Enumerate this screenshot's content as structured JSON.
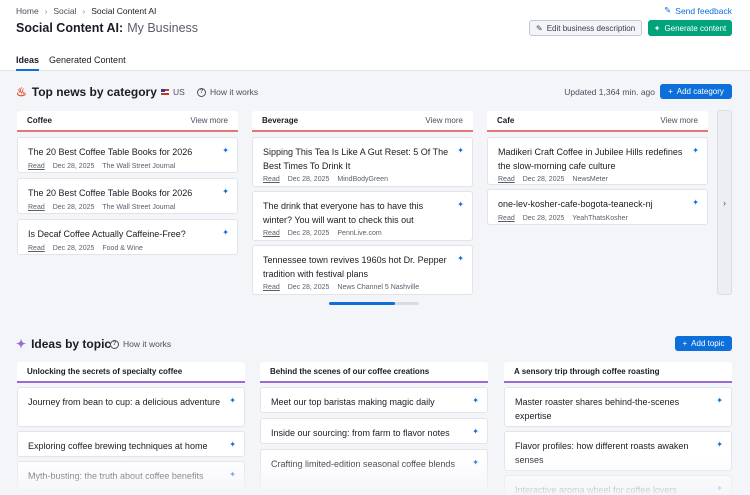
{
  "breadcrumb": [
    "Home",
    "Social",
    "Social Content AI"
  ],
  "send_feedback": "Send feedback",
  "title": {
    "app": "Social Content AI:",
    "business": "My Business"
  },
  "buttons": {
    "edit": "Edit business description",
    "generate": "Generate content",
    "add_category": "Add category",
    "add_topic": "Add topic"
  },
  "tabs": [
    {
      "label": "Ideas",
      "active": true
    },
    {
      "label": "Generated Content",
      "active": false
    }
  ],
  "top_news": {
    "title": "Top news by category",
    "region": "US",
    "how": "How it works",
    "updated": "Updated 1,364 min. ago",
    "view_more": "View more",
    "columns": [
      {
        "name": "Coffee",
        "items": [
          {
            "title": "The 20 Best Coffee Table Books for 2026",
            "read": "Read",
            "date": "Dec 28, 2025",
            "source": "The Wall Street Journal"
          },
          {
            "title": "The 20 Best Coffee Table Books for 2026",
            "read": "Read",
            "date": "Dec 28, 2025",
            "source": "The Wall Street Journal"
          },
          {
            "title": "Is Decaf Coffee Actually Caffeine-Free?",
            "read": "Read",
            "date": "Dec 28, 2025",
            "source": "Food & Wine"
          }
        ]
      },
      {
        "name": "Beverage",
        "items": [
          {
            "title": "Sipping This Tea Is Like A Gut Reset: 5 Of The Best Times To Drink It",
            "read": "Read",
            "date": "Dec 28, 2025",
            "source": "MindBodyGreen"
          },
          {
            "title": "The drink that everyone has to have this winter? You will want to check this out",
            "read": "Read",
            "date": "Dec 28, 2025",
            "source": "PennLive.com"
          },
          {
            "title": "Tennessee town revives 1960s hot Dr. Pepper tradition with festival plans",
            "read": "Read",
            "date": "Dec 28, 2025",
            "source": "News Channel 5 Nashville"
          }
        ]
      },
      {
        "name": "Cafe",
        "items": [
          {
            "title": "Madikeri Craft Coffee in Jubilee Hills redefines the slow-morning cafe culture",
            "read": "Read",
            "date": "Dec 28, 2025",
            "source": "NewsMeter"
          },
          {
            "title": "one-lev-kosher-cafe-bogota-teaneck-nj",
            "read": "Read",
            "date": "Dec 28, 2025",
            "source": "YeahThatsKosher"
          }
        ]
      }
    ]
  },
  "ideas": {
    "title": "Ideas by topic",
    "how": "How it works",
    "columns": [
      {
        "name": "Unlocking the secrets of specialty coffee",
        "items": [
          "Journey from bean to cup: a delicious adventure",
          "Exploring coffee brewing techniques at home",
          "Myth-busting: the truth about coffee benefits"
        ]
      },
      {
        "name": "Behind the scenes of our coffee creations",
        "items": [
          "Meet our top baristas making magic daily",
          "Inside our sourcing: from farm to flavor notes",
          "Crafting limited-edition seasonal coffee blends"
        ]
      },
      {
        "name": "A sensory trip through coffee roasting",
        "items": [
          "Master roaster shares behind-the-scenes expertise",
          "Flavor profiles: how different roasts awaken senses",
          "Interactive aroma wheel for coffee lovers"
        ]
      }
    ]
  },
  "colors": {
    "accent_blue": "#0d6fd9",
    "accent_green": "#00a37a",
    "news_underline": "#e57777",
    "topic_underline": "#9a6bd6"
  }
}
